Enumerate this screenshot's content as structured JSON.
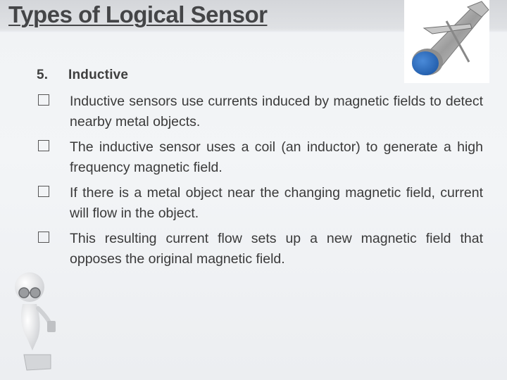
{
  "slide": {
    "title": "Types of Logical Sensor",
    "section": {
      "number": "5.",
      "heading": "Inductive"
    },
    "bullets": [
      "Inductive sensors use currents induced by magnetic fields to detect nearby metal objects.",
      "The inductive sensor uses a coil (an inductor) to generate a high frequency magnetic field.",
      "If there is a metal object near the changing magnetic field, current will flow in the object.",
      "This resulting current flow sets up a new magnetic field that opposes the original magnetic field."
    ],
    "images": {
      "sensor": "inductive-proximity-sensor-photo",
      "figure": "3d-person-with-puzzle-piece"
    },
    "colors": {
      "title": "#444547",
      "text": "#3a3a3a",
      "sensor_cap": "#2f6fbf"
    }
  }
}
